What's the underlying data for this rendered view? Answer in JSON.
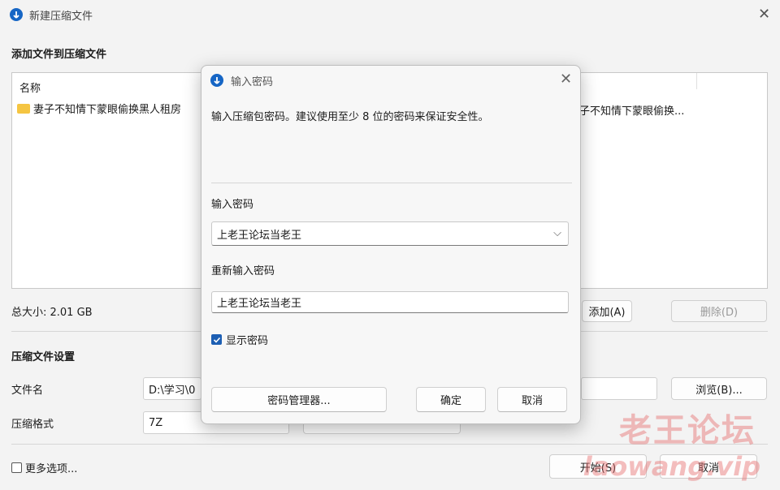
{
  "main": {
    "title": "新建压缩文件",
    "add_section_title": "添加文件到压缩文件",
    "column_name": "名称",
    "file_item_name": "妻子不知情下蒙眼偷换黑人租房",
    "file_item_right": "子不知情下蒙眼偷换...",
    "total_size": "总大小: 2.01 GB",
    "add_button": "添加(A)",
    "delete_button": "删除(D)",
    "settings_section_title": "压缩文件设置",
    "filename_label": "文件名",
    "filename_value": "D:\\学习\\0",
    "browse_button": "浏览(B)...",
    "format_label": "压缩格式",
    "format_value": "7Z",
    "more_options_label": "更多选项...",
    "start_button": "开始(S)",
    "cancel_button": "取消"
  },
  "dialog": {
    "title": "输入密码",
    "description": "输入压缩包密码。建议使用至少 8 位的密码来保证安全性。",
    "password_label": "输入密码",
    "password_value": "上老王论坛当老王",
    "reenter_label": "重新输入密码",
    "reenter_value": "上老王论坛当老王",
    "show_password_label": "显示密码",
    "show_password_checked": true,
    "manager_button": "密码管理器...",
    "ok_button": "确定",
    "cancel_button": "取消"
  },
  "watermark": {
    "cn": "老王论坛",
    "en": "laowang.vip"
  },
  "colors": {
    "accent": "#1d5fb3",
    "window_bg": "#f3f3f3",
    "watermark": "#e66e6e"
  }
}
